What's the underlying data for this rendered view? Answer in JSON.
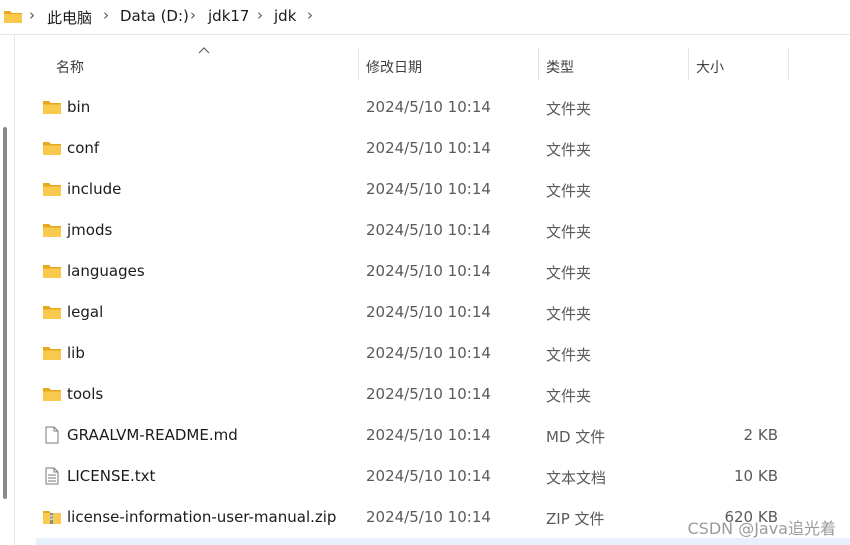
{
  "breadcrumb": {
    "items": [
      {
        "label": "此电脑"
      },
      {
        "label": "Data (D:)"
      },
      {
        "label": "jdk17"
      },
      {
        "label": "jdk"
      }
    ]
  },
  "columns": {
    "name": "名称",
    "date": "修改日期",
    "type": "类型",
    "size": "大小"
  },
  "files": [
    {
      "name": "bin",
      "date": "2024/5/10 10:14",
      "type": "文件夹",
      "size": "",
      "icon": "folder-icon"
    },
    {
      "name": "conf",
      "date": "2024/5/10 10:14",
      "type": "文件夹",
      "size": "",
      "icon": "folder-icon"
    },
    {
      "name": "include",
      "date": "2024/5/10 10:14",
      "type": "文件夹",
      "size": "",
      "icon": "folder-icon"
    },
    {
      "name": "jmods",
      "date": "2024/5/10 10:14",
      "type": "文件夹",
      "size": "",
      "icon": "folder-icon"
    },
    {
      "name": "languages",
      "date": "2024/5/10 10:14",
      "type": "文件夹",
      "size": "",
      "icon": "folder-icon"
    },
    {
      "name": "legal",
      "date": "2024/5/10 10:14",
      "type": "文件夹",
      "size": "",
      "icon": "folder-icon"
    },
    {
      "name": "lib",
      "date": "2024/5/10 10:14",
      "type": "文件夹",
      "size": "",
      "icon": "folder-icon"
    },
    {
      "name": "tools",
      "date": "2024/5/10 10:14",
      "type": "文件夹",
      "size": "",
      "icon": "folder-icon"
    },
    {
      "name": "GRAALVM-README.md",
      "date": "2024/5/10 10:14",
      "type": "MD 文件",
      "size": "2 KB",
      "icon": "file-icon"
    },
    {
      "name": "LICENSE.txt",
      "date": "2024/5/10 10:14",
      "type": "文本文档",
      "size": "10 KB",
      "icon": "text-file-icon"
    },
    {
      "name": "license-information-user-manual.zip",
      "date": "2024/5/10 10:14",
      "type": "ZIP 文件",
      "size": "620 KB",
      "icon": "zip-file-icon"
    }
  ],
  "watermark": "CSDN @Java追光着",
  "colors": {
    "folder": "#f8c94c",
    "folder_dark": "#e6a91e",
    "selection": "#e8f1fb",
    "secondary_text": "#5a5a5a"
  }
}
